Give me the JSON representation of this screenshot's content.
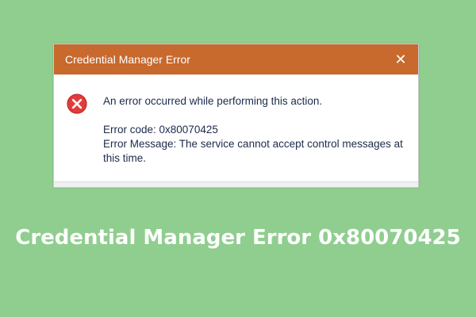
{
  "dialog": {
    "title": "Credential Manager Error",
    "close_glyph": "✕",
    "icon": "error-x-icon",
    "main_instruction": "An error occurred while performing this action.",
    "error_code_line": "Error code: 0x80070425",
    "error_message_line": "Error Message: The service cannot accept control messages at this time."
  },
  "banner": {
    "text": "Credential Manager Error 0x80070425"
  },
  "colors": {
    "background": "#8fce8f",
    "titlebar": "#c8692d",
    "error_icon": "#e23b3b",
    "text": "#1c2a4a"
  }
}
